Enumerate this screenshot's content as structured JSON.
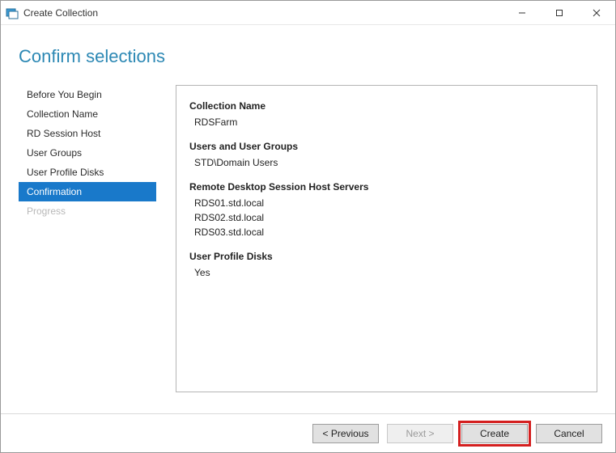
{
  "window": {
    "title": "Create Collection"
  },
  "page": {
    "heading": "Confirm selections"
  },
  "nav": {
    "items": [
      {
        "label": "Before You Begin",
        "state": "normal"
      },
      {
        "label": "Collection Name",
        "state": "normal"
      },
      {
        "label": "RD Session Host",
        "state": "normal"
      },
      {
        "label": "User Groups",
        "state": "normal"
      },
      {
        "label": "User Profile Disks",
        "state": "normal"
      },
      {
        "label": "Confirmation",
        "state": "selected"
      },
      {
        "label": "Progress",
        "state": "disabled"
      }
    ]
  },
  "summary": {
    "collection_name": {
      "label": "Collection Name",
      "value": "RDSFarm"
    },
    "user_groups": {
      "label": "Users and User Groups",
      "values": [
        "STD\\Domain Users"
      ]
    },
    "session_hosts": {
      "label": "Remote Desktop Session Host Servers",
      "values": [
        "RDS01.std.local",
        "RDS02.std.local",
        "RDS03.std.local"
      ]
    },
    "profile_disks": {
      "label": "User Profile Disks",
      "value": "Yes"
    }
  },
  "buttons": {
    "previous": "< Previous",
    "next": "Next >",
    "create": "Create",
    "cancel": "Cancel"
  }
}
